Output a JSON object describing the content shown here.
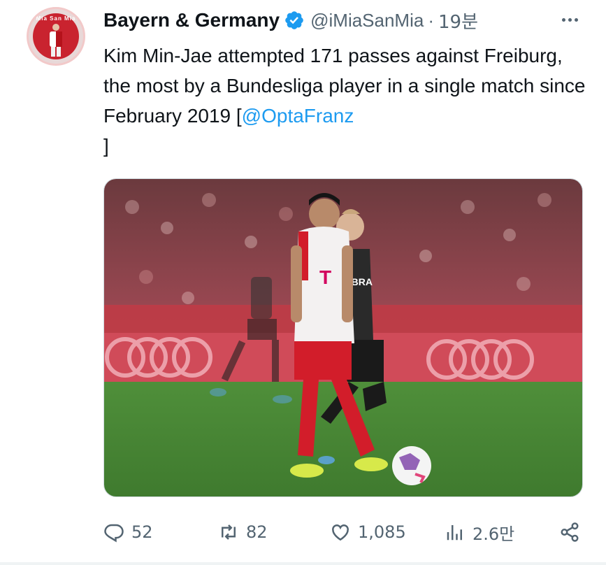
{
  "author": {
    "display_name": "Bayern & Germany",
    "handle": "@iMiaSanMia",
    "separator": "·",
    "time": "19분",
    "avatar_ring_text": "Mia San Mia"
  },
  "tweet": {
    "text": "Kim Min-Jae attempted 171 passes against Freiburg, the most by a Bundesliga player in a single match since February 2019 [",
    "mention": "@OptaFranz",
    "text_end": "]"
  },
  "media": {
    "alt": "Kim Min-Jae passing the ball against Freiburg",
    "jersey_sponsor": "JOBRA"
  },
  "actions": {
    "replies": "52",
    "reposts": "82",
    "likes": "1,085",
    "views": "2.6만"
  },
  "icons": {
    "verified": "verified-badge-icon",
    "more": "more-icon",
    "reply": "reply-icon",
    "repost": "repost-icon",
    "like": "like-icon",
    "views": "views-icon",
    "share": "share-icon"
  },
  "colors": {
    "accent": "#1d9bf0",
    "text": "#0f1419",
    "secondary": "#536471"
  }
}
